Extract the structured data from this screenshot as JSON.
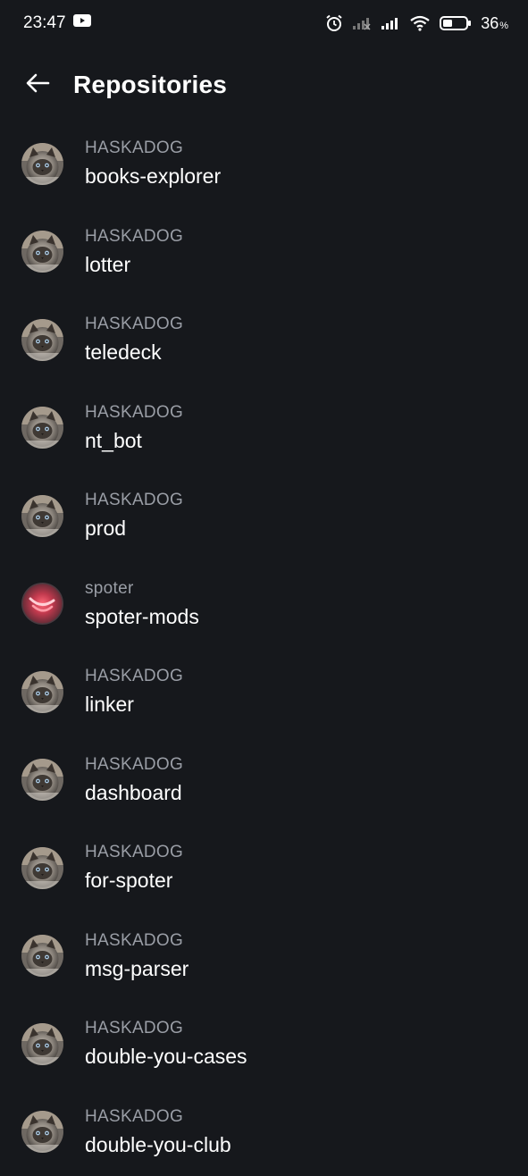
{
  "status_bar": {
    "time": "23:47",
    "battery_percent": "36",
    "battery_unit": "%",
    "icons": [
      "youtube-icon",
      "alarm-icon",
      "signal-no-service-icon",
      "signal-icon",
      "wifi-icon",
      "battery-icon"
    ]
  },
  "header": {
    "title": "Repositories",
    "back_icon": "arrow-left-icon"
  },
  "repositories": [
    {
      "owner": "HASKADOG",
      "name": "books-explorer",
      "avatar": "cat"
    },
    {
      "owner": "HASKADOG",
      "name": "lotter",
      "avatar": "cat"
    },
    {
      "owner": "HASKADOG",
      "name": "teledeck",
      "avatar": "cat"
    },
    {
      "owner": "HASKADOG",
      "name": "nt_bot",
      "avatar": "cat"
    },
    {
      "owner": "HASKADOG",
      "name": "prod",
      "avatar": "cat"
    },
    {
      "owner": "spoter",
      "name": "spoter-mods",
      "avatar": "pink"
    },
    {
      "owner": "HASKADOG",
      "name": "linker",
      "avatar": "cat"
    },
    {
      "owner": "HASKADOG",
      "name": "dashboard",
      "avatar": "cat"
    },
    {
      "owner": "HASKADOG",
      "name": "for-spoter",
      "avatar": "cat"
    },
    {
      "owner": "HASKADOG",
      "name": "msg-parser",
      "avatar": "cat"
    },
    {
      "owner": "HASKADOG",
      "name": "double-you-cases",
      "avatar": "cat"
    },
    {
      "owner": "HASKADOG",
      "name": "double-you-club",
      "avatar": "cat"
    }
  ]
}
